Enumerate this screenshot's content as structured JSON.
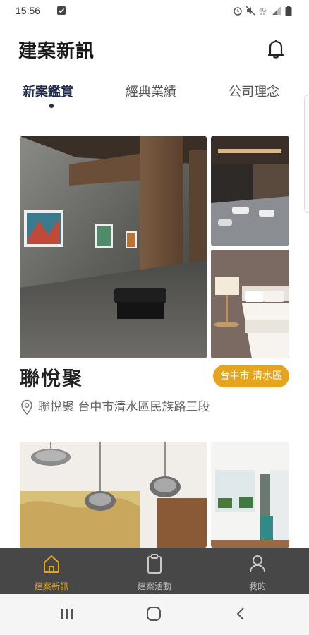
{
  "status_bar": {
    "time": "15:56"
  },
  "header": {
    "title": "建案新訊"
  },
  "tabs": [
    {
      "label": "新案鑑賞",
      "active": true
    },
    {
      "label": "經典業績",
      "active": false
    },
    {
      "label": "公司理念",
      "active": false
    }
  ],
  "projects": [
    {
      "title": "聯悅聚",
      "region": "台中市 清水區",
      "address": "聯悅聚 台中市清水區民族路三段"
    }
  ],
  "bottom_nav": [
    {
      "label": "建案新訊",
      "icon": "home-icon",
      "active": true
    },
    {
      "label": "建案活動",
      "icon": "clipboard-icon",
      "active": false
    },
    {
      "label": "我的",
      "icon": "user-icon",
      "active": false
    }
  ],
  "colors": {
    "accent": "#e5a41d",
    "tab_active": "#1e2a4a",
    "bottom_nav_bg": "#474747"
  }
}
